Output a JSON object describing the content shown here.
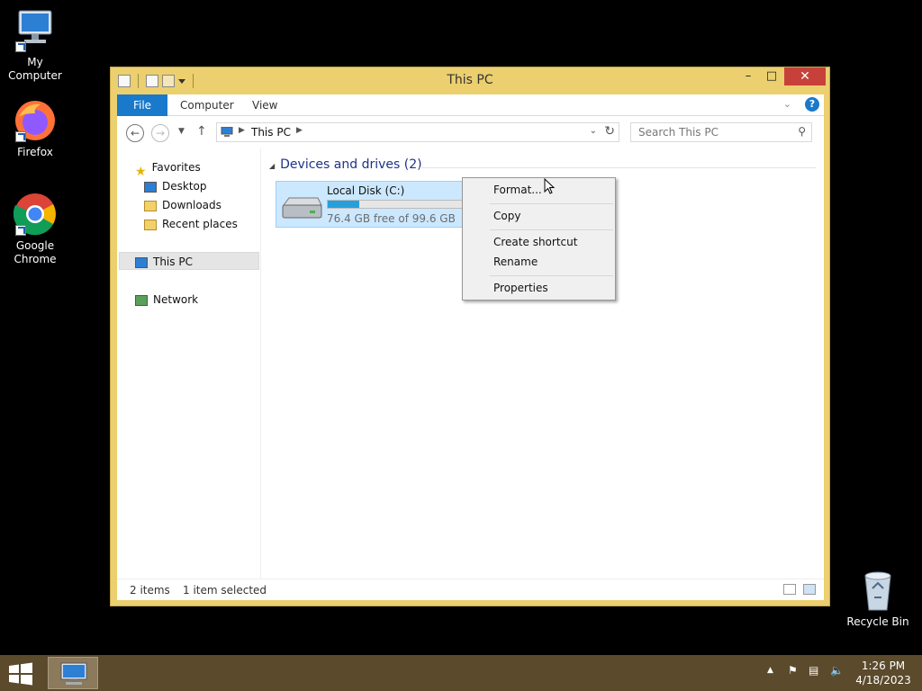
{
  "desktop": {
    "icons": [
      {
        "label": "My Computer",
        "icon": "computer-icon"
      },
      {
        "label": "Firefox",
        "icon": "firefox-icon"
      },
      {
        "label": "Google Chrome",
        "icon": "chrome-icon"
      },
      {
        "label": "Recycle Bin",
        "icon": "recycle-bin-icon"
      }
    ]
  },
  "window": {
    "title": "This PC",
    "controls": {
      "minimize": "–",
      "maximize": "□",
      "close": "✕"
    },
    "ribbon": {
      "tabs": [
        "File",
        "Computer",
        "View"
      ],
      "help": "?"
    },
    "address": {
      "crumb": "This PC",
      "search_placeholder": "Search This PC"
    },
    "nav_pane": {
      "favorites": "Favorites",
      "desktop": "Desktop",
      "downloads": "Downloads",
      "recent": "Recent places",
      "this_pc": "This PC",
      "network": "Network"
    },
    "group": {
      "title": "Devices and drives (2)"
    },
    "drive": {
      "name": "Local Disk (C:)",
      "space": "76.4 GB free of 99.6 GB",
      "used_fraction": 0.233
    },
    "status": {
      "items": "2 items",
      "selected": "1 item selected"
    }
  },
  "context_menu": {
    "items": [
      "Format...",
      "Copy",
      "Create shortcut",
      "Rename",
      "Properties"
    ]
  },
  "taskbar": {
    "time": "1:26 PM",
    "date": "4/18/2023"
  },
  "colors": {
    "window_frame": "#eccf6e",
    "ribbon_file_tab": "#1979ca",
    "selection": "#cce8ff",
    "taskbar": "#5b4a2c",
    "close_button": "#c7413a"
  }
}
